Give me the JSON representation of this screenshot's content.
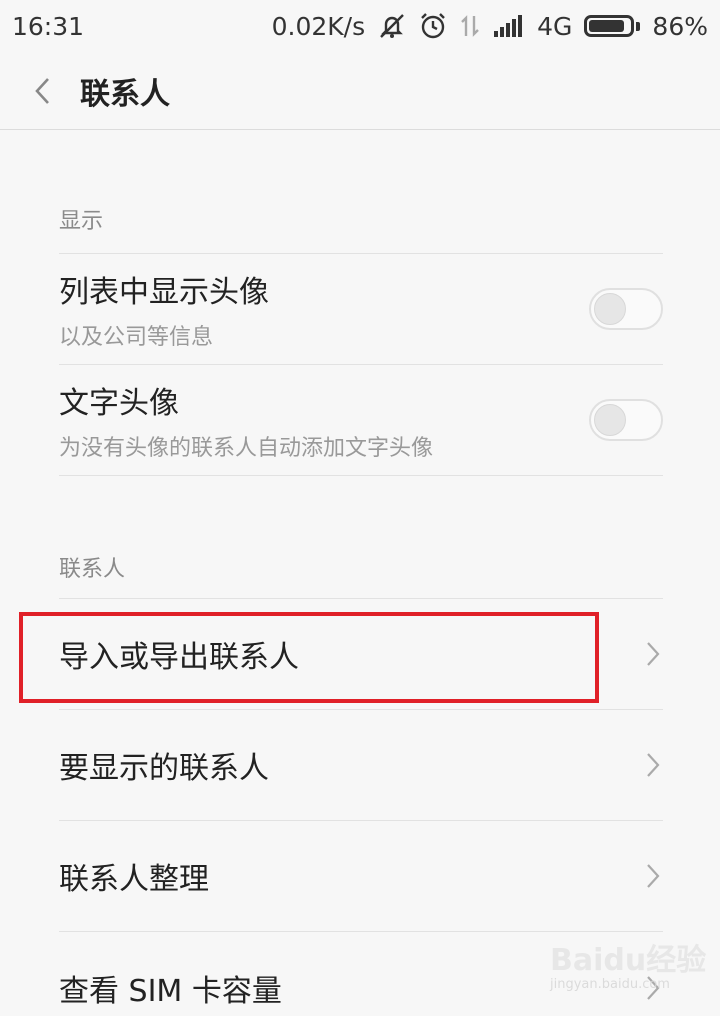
{
  "status_bar": {
    "time": "16:31",
    "net_speed": "0.02K/s",
    "network": "4G",
    "battery": "86%",
    "battery_level": 0.86,
    "icons": [
      "mute-icon",
      "alarm-icon",
      "data-transfer-icon",
      "signal-icon",
      "battery-icon"
    ]
  },
  "header": {
    "title": "联系人",
    "back_icon": "chevron-left-icon"
  },
  "sections": {
    "display": {
      "header": "显示",
      "items": [
        {
          "label": "列表中显示头像",
          "sub": "以及公司等信息",
          "toggle_on": false
        },
        {
          "label": "文字头像",
          "sub": "为没有头像的联系人自动添加文字头像",
          "toggle_on": false
        }
      ]
    },
    "contacts": {
      "header": "联系人",
      "items": [
        {
          "label": "导入或导出联系人",
          "highlighted": true
        },
        {
          "label": "要显示的联系人"
        },
        {
          "label": "联系人整理"
        },
        {
          "label": "查看 SIM 卡容量"
        }
      ]
    }
  },
  "colors": {
    "background": "#f7f7f7",
    "highlight": "#e02028",
    "secondary_text": "#999999"
  },
  "watermark": {
    "brand": "Baidu经验",
    "url": "jingyan.baidu.com"
  }
}
